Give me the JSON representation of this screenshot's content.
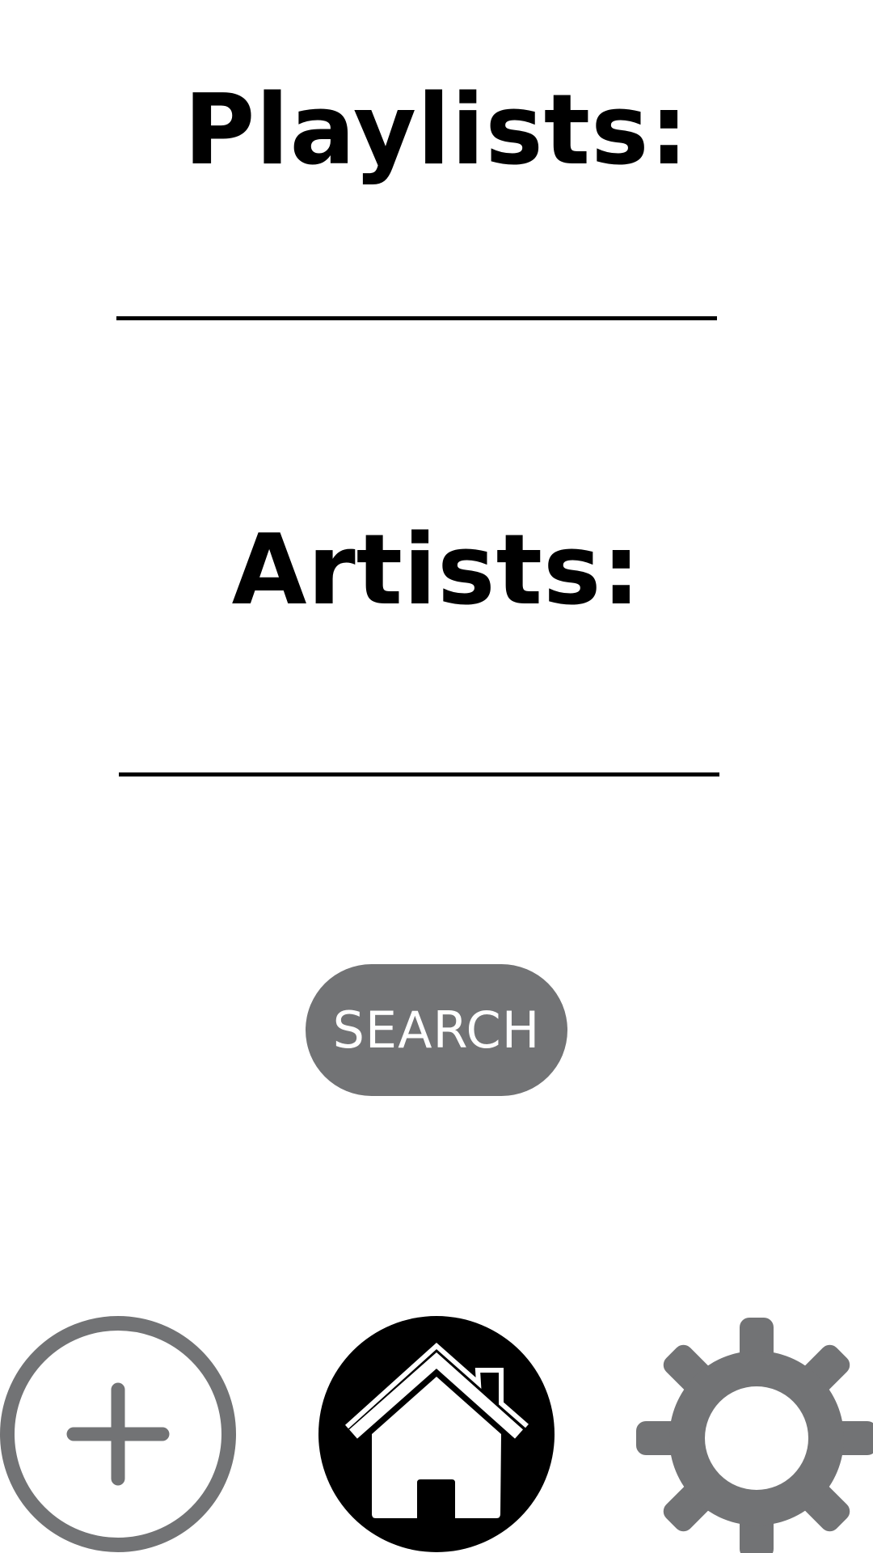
{
  "sections": {
    "playlists_label": "Playlists:",
    "artists_label": "Artists:"
  },
  "search": {
    "button_label": "SEARCH"
  },
  "bottom_nav": {
    "items": [
      {
        "icon": "add-circle-icon"
      },
      {
        "icon": "home-icon"
      },
      {
        "icon": "gear-icon"
      }
    ]
  },
  "colors": {
    "accent_gray": "#727375",
    "text": "#000000",
    "background": "#ffffff"
  }
}
